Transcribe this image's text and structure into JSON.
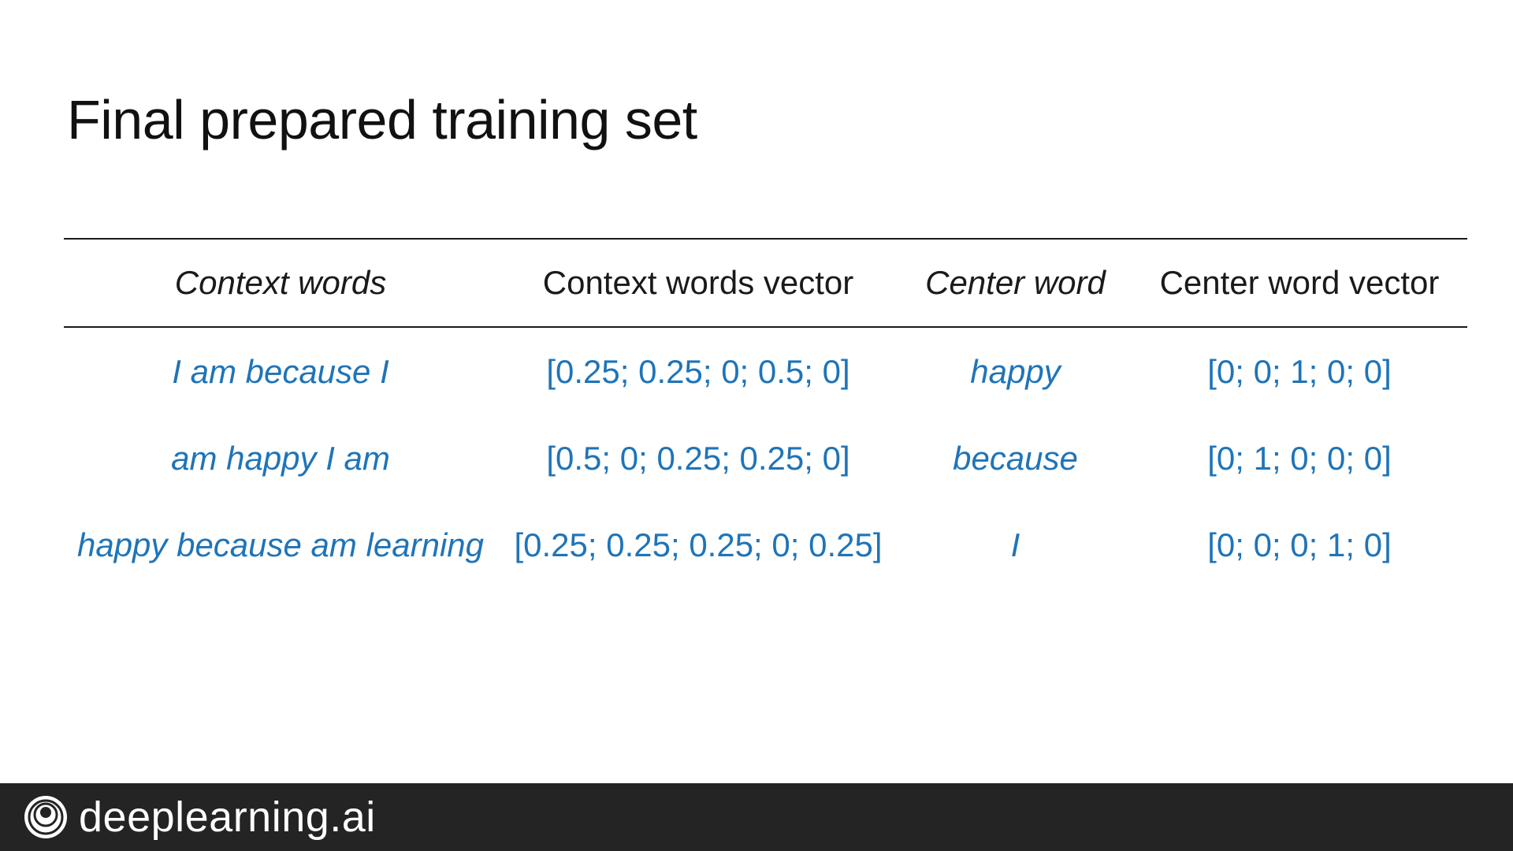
{
  "slide": {
    "title": "Final prepared training set"
  },
  "table": {
    "headers": [
      "Context words",
      "Context words vector",
      "Center word",
      "Center word vector"
    ],
    "rows": [
      {
        "context_words": "I am because I",
        "context_vector": "[0.25; 0.25; 0; 0.5; 0]",
        "center_word": "happy",
        "center_vector": "[0; 0; 1; 0; 0]"
      },
      {
        "context_words": "am happy I am",
        "context_vector": "[0.5; 0; 0.25; 0.25; 0]",
        "center_word": "because",
        "center_vector": "[0; 1; 0; 0; 0]"
      },
      {
        "context_words": "happy because am learning",
        "context_vector": "[0.25; 0.25; 0.25; 0; 0.25]",
        "center_word": "I",
        "center_vector": "[0; 0; 0; 1; 0]"
      }
    ]
  },
  "footer": {
    "brand": "deeplearning.ai",
    "logo_icon": "deeplearning-logo-icon"
  },
  "colors": {
    "text": "#1a1a1a",
    "accent_blue": "#1f74b8",
    "footer_bg": "#242424"
  }
}
